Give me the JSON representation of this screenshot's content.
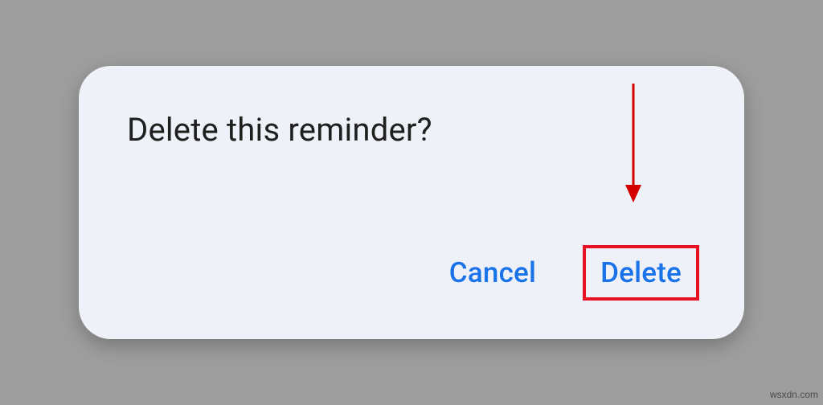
{
  "dialog": {
    "title": "Delete this reminder?",
    "cancel_label": "Cancel",
    "delete_label": "Delete"
  },
  "watermark": "wsxdn.com",
  "annotation": {
    "arrow_target": "delete-button",
    "highlight_target": "delete-button"
  }
}
